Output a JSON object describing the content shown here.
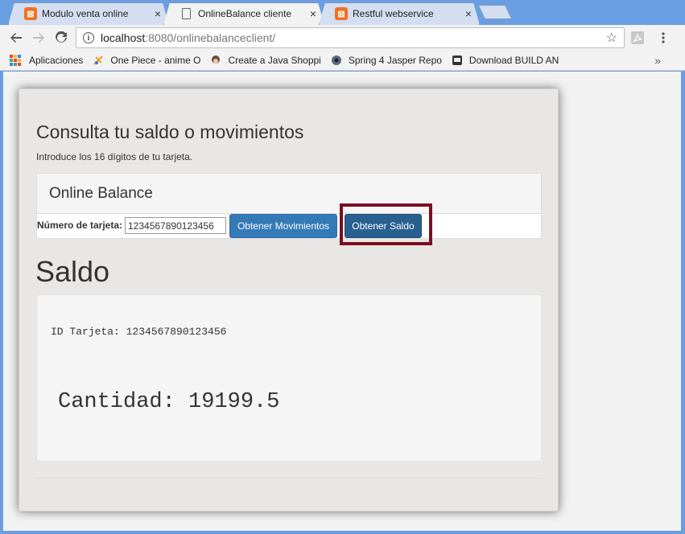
{
  "browser": {
    "tabs": [
      {
        "label": "Modulo venta online",
        "close": "×"
      },
      {
        "label": "OnlineBalance cliente",
        "close": "×"
      },
      {
        "label": "Restful webservice",
        "close": "×"
      }
    ],
    "address": {
      "host": "localhost",
      "path": ":8080/onlinebalanceclient/"
    },
    "bookmarks": [
      {
        "label": "Aplicaciones"
      },
      {
        "label": "One Piece - anime O",
        "fade": "n"
      },
      {
        "label": "Create a Java Shoppi",
        "fade": "n"
      },
      {
        "label": "Spring 4 Jasper Repo",
        "fade": "r"
      },
      {
        "label": "Download BUILD AN",
        "fade": "D"
      }
    ],
    "overflow": "»"
  },
  "page": {
    "heading": "Consulta tu saldo o movimientos",
    "intro": "Introduce los 16 dígitos de tu tarjeta.",
    "panel_title": "Online Balance",
    "form": {
      "card_label": "Número de tarjeta:",
      "card_value": "1234567890123456",
      "btn_movimientos": "Obtener Movimientos",
      "btn_saldo": "Obtener Saldo"
    },
    "saldo_title": "Saldo",
    "result": {
      "id_line": "ID Tarjeta: 1234567890123456",
      "amount_line": "Cantidad: 19199.5"
    }
  },
  "colors": {
    "primary": "#337ab7",
    "primary_active": "#286090",
    "highlight": "#7b0f1e",
    "xampp": "#f37021"
  }
}
